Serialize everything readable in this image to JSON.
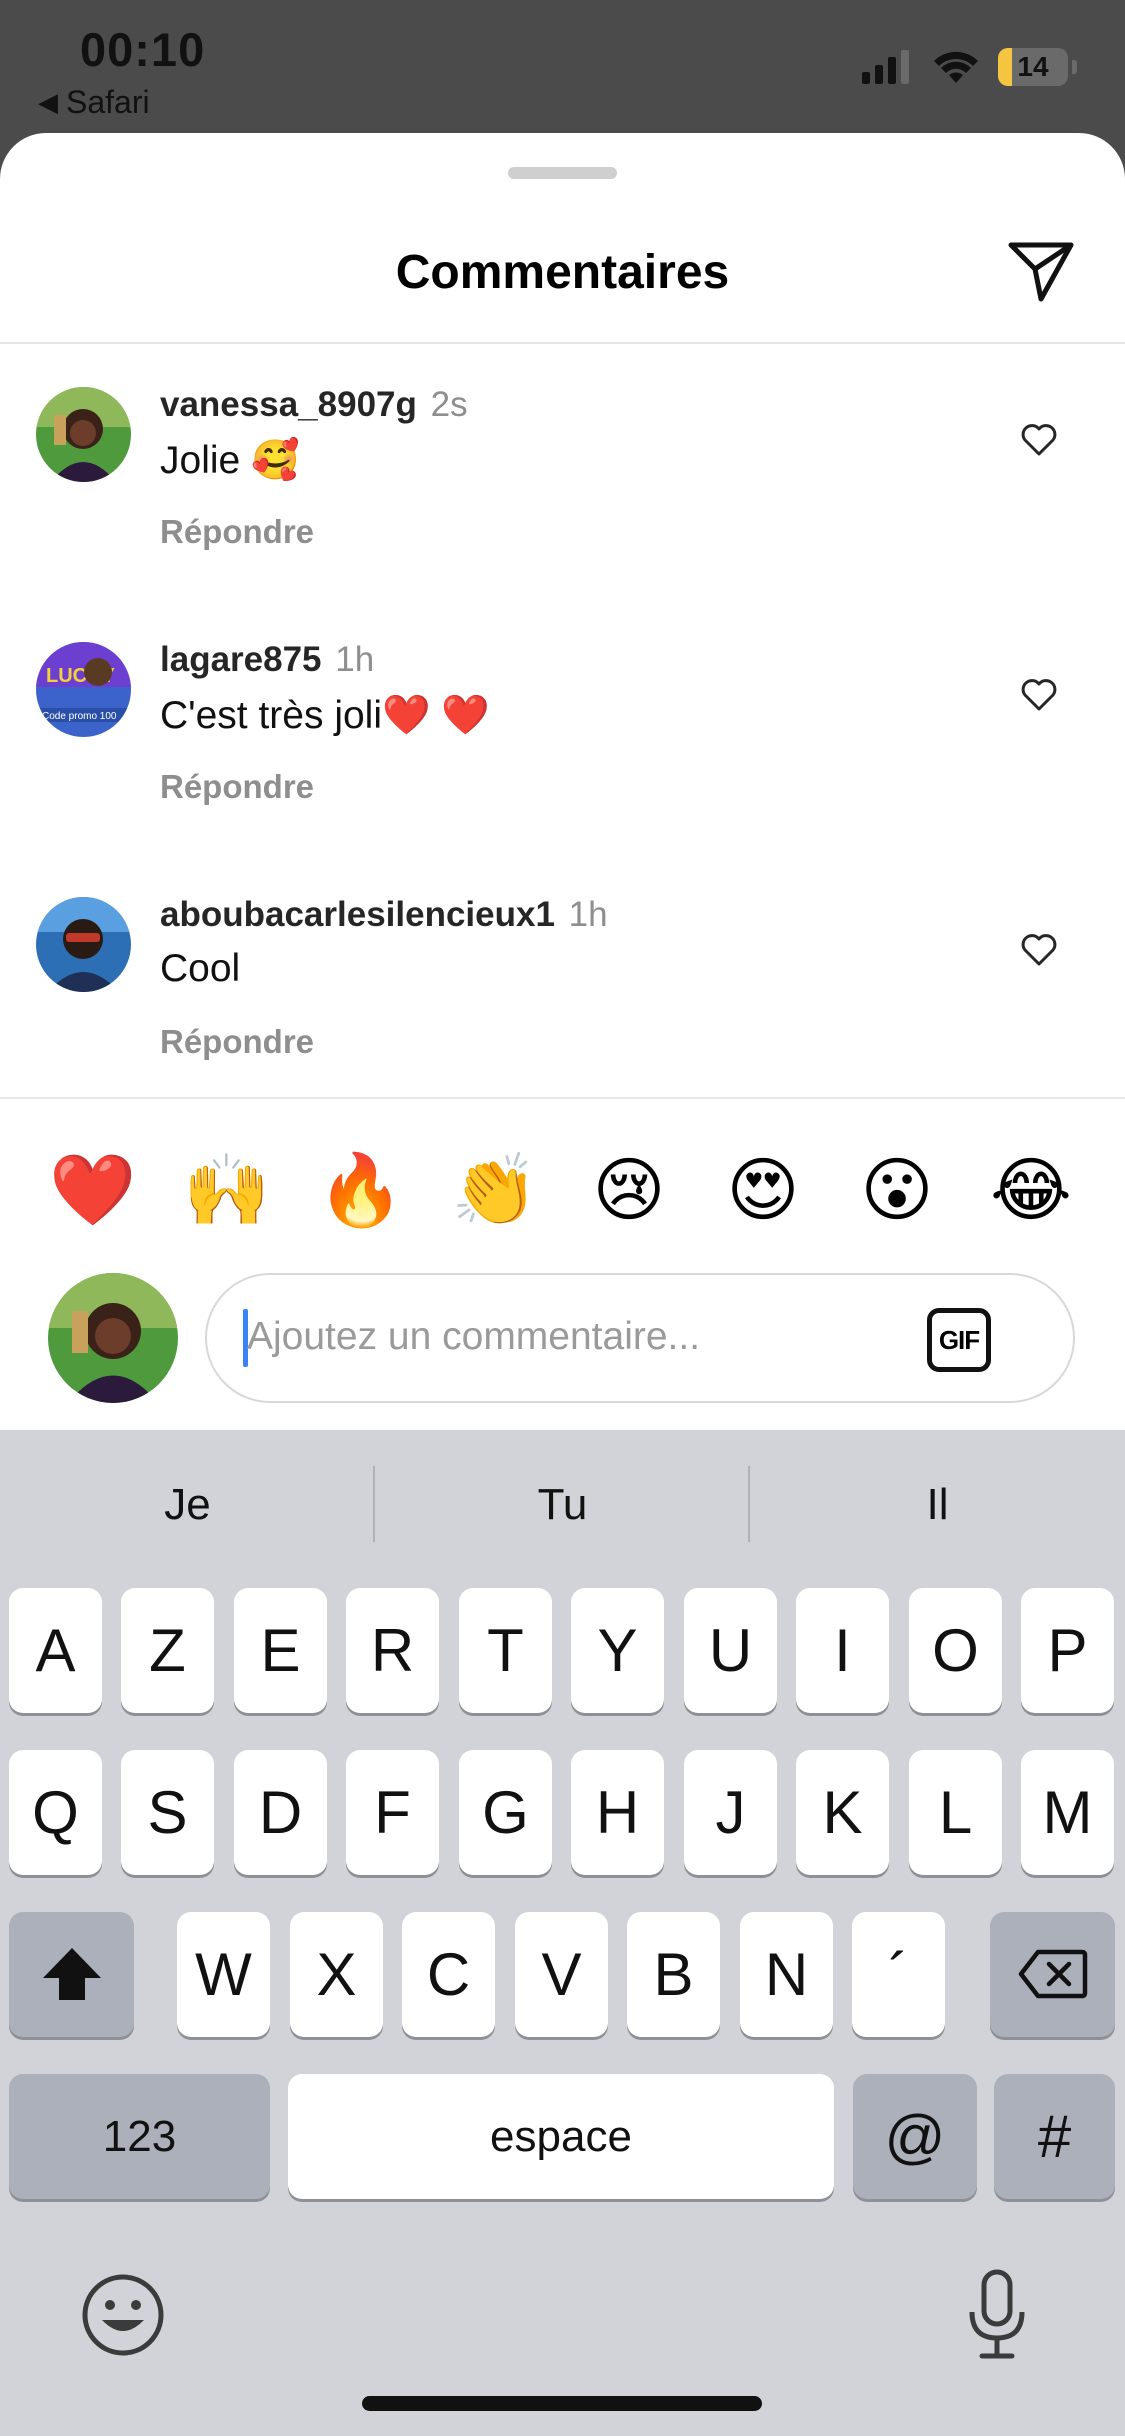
{
  "status_bar": {
    "time": "00:10",
    "back_label": "Safari",
    "back_icon": "back-triangle-icon",
    "battery_level": "14",
    "battery_color": "#f5c542"
  },
  "sheet": {
    "title": "Commentaires",
    "send_icon": "paper-plane-icon"
  },
  "comments": [
    {
      "username": "vanessa_8907g",
      "time": "2s",
      "text": "Jolie 🥰",
      "reply_label": "Répondre"
    },
    {
      "username": "lagare875",
      "time": "1h",
      "text": "C'est très joli❤️ ❤️",
      "reply_label": "Répondre"
    },
    {
      "username": "aboubacarlesilencieux1",
      "time": "1h",
      "text": "Cool",
      "reply_label": "Répondre"
    }
  ],
  "quick_emojis": [
    "❤️",
    "🙌",
    "🔥",
    "👏",
    "😢",
    "😍",
    "😮",
    "😂"
  ],
  "composer": {
    "placeholder": "Ajoutez un commentaire...",
    "gif_label": "GIF"
  },
  "keyboard": {
    "suggestions": [
      "Je",
      "Tu",
      "Il"
    ],
    "row1": [
      "A",
      "Z",
      "E",
      "R",
      "T",
      "Y",
      "U",
      "I",
      "O",
      "P"
    ],
    "row2": [
      "Q",
      "S",
      "D",
      "F",
      "G",
      "H",
      "J",
      "K",
      "L",
      "M"
    ],
    "row3": [
      "W",
      "X",
      "C",
      "V",
      "B",
      "N",
      "´"
    ],
    "numbers_label": "123",
    "space_label": "espace",
    "at_label": "@",
    "hash_label": "#"
  }
}
